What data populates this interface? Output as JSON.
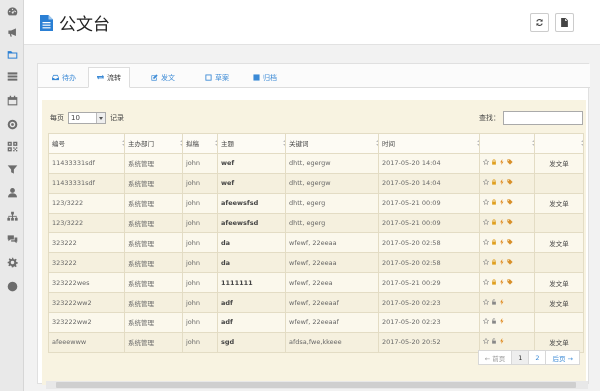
{
  "page": {
    "title": "公文台"
  },
  "tabs": [
    {
      "label": "待办",
      "icon": "inbox-icon"
    },
    {
      "label": "流转",
      "icon": "exchange-icon"
    },
    {
      "label": "发文",
      "icon": "edit-icon"
    },
    {
      "label": "草案",
      "icon": "draft-icon"
    },
    {
      "label": "归档",
      "icon": "archive-icon"
    }
  ],
  "active_tab": "流转",
  "controls": {
    "per_page_label": "每页",
    "per_page_value": "10",
    "records_label": "记录",
    "search_label": "查找："
  },
  "table": {
    "headers": [
      "编号",
      "主办部门",
      "拟稿",
      "主题",
      "关键词",
      "时间",
      "",
      ""
    ],
    "rows": [
      {
        "id": "11433331sdf",
        "dept": "系统管理",
        "drafter": "john",
        "subject": "wef",
        "keywords": "dhtt, egergw",
        "time": "2017-05-20 14:04",
        "action": "发文单"
      },
      {
        "id": "11433331sdf",
        "dept": "系统管理",
        "drafter": "john",
        "subject": "wef",
        "keywords": "dhtt, egergw",
        "time": "2017-05-20 14:04",
        "action": ""
      },
      {
        "id": "123/3222",
        "dept": "系统管理",
        "drafter": "john",
        "subject": "afeewsfsd",
        "keywords": "dhtt, egerg",
        "time": "2017-05-21 00:09",
        "action": "发文单"
      },
      {
        "id": "123/3222",
        "dept": "系统管理",
        "drafter": "john",
        "subject": "afeewsfsd",
        "keywords": "dhtt, egerg",
        "time": "2017-05-21 00:09",
        "action": ""
      },
      {
        "id": "323222",
        "dept": "系统管理",
        "drafter": "john",
        "subject": "da",
        "keywords": "wfewf, 22eeaa",
        "time": "2017-05-20 02:58",
        "action": "发文单"
      },
      {
        "id": "323222",
        "dept": "系统管理",
        "drafter": "john",
        "subject": "da",
        "keywords": "wfewf, 22eeaa",
        "time": "2017-05-20 02:58",
        "action": ""
      },
      {
        "id": "323222wes",
        "dept": "系统管理",
        "drafter": "john",
        "subject": "1111111",
        "keywords": "wfewf, 22eea",
        "time": "2017-05-21 00:29",
        "action": "发文单"
      },
      {
        "id": "323222ww2",
        "dept": "系统管理",
        "drafter": "john",
        "subject": "adf",
        "keywords": "wfewf, 22eeaaf",
        "time": "2017-05-20 02:23",
        "action": "发文单"
      },
      {
        "id": "323222ww2",
        "dept": "系统管理",
        "drafter": "john",
        "subject": "adf",
        "keywords": "wfewf, 22eeaaf",
        "time": "2017-05-20 02:23",
        "action": ""
      },
      {
        "id": "afeeewww",
        "dept": "系统管理",
        "drafter": "john",
        "subject": "sgd",
        "keywords": "afdsa,fwe,kkeee",
        "time": "2017-05-20 20:52",
        "action": "发文单"
      }
    ]
  },
  "pager": {
    "prev": "← 前页",
    "pages": [
      "1",
      "2"
    ],
    "current": "1",
    "next": "后页 →"
  },
  "sidebar_icons": [
    "dashboard-icon",
    "bullhorn-icon",
    "folder-icon",
    "list-icon",
    "calendar-icon",
    "circle-icon",
    "qrcode-icon",
    "filter-icon",
    "user-icon",
    "sitemap-icon",
    "comments-icon",
    "gear-icon",
    "globe-icon"
  ],
  "colors": {
    "accent": "#2a7fd4",
    "table_bg": "#f8f3e1",
    "star": "#888888",
    "lock": "#e0a020",
    "bolt": "#e08a20",
    "tag": "#d8902a"
  }
}
